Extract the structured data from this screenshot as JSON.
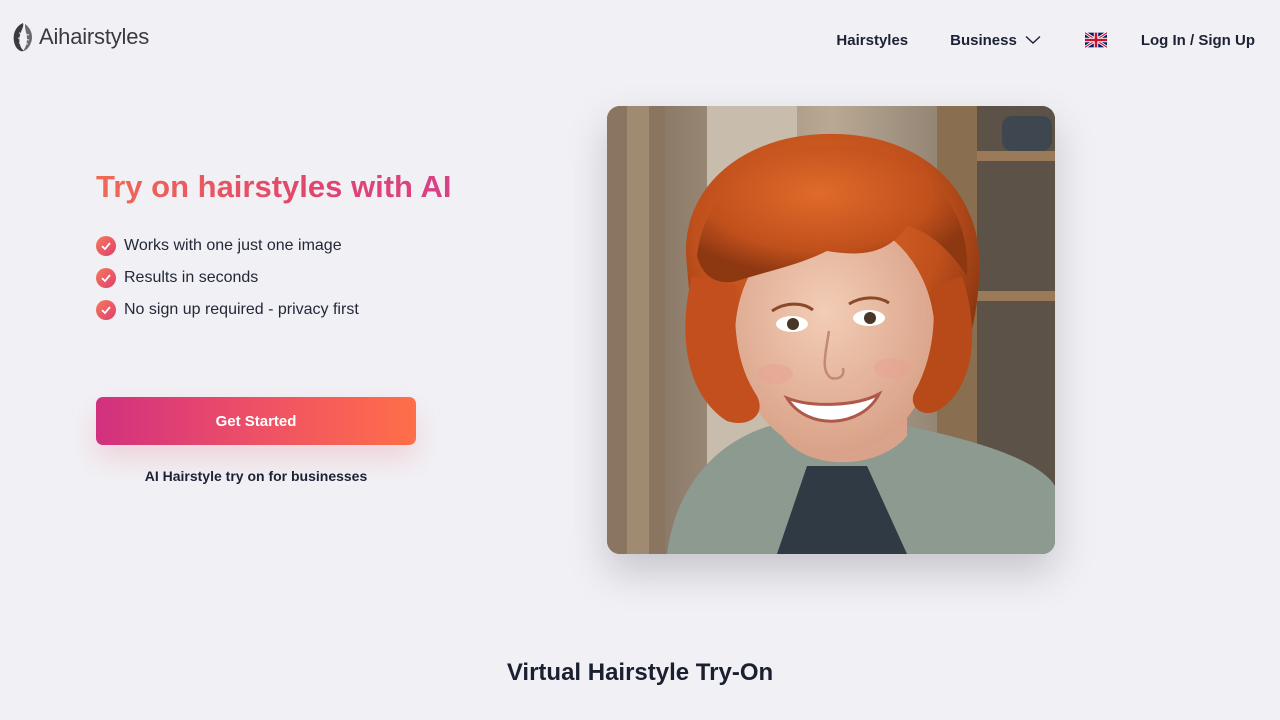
{
  "header": {
    "logo_text": "Aihairstyles",
    "logo_icon": "hair-feather-logo",
    "nav": {
      "hairstyles": "Hairstyles",
      "business": "Business",
      "language_icon": "uk-flag-icon",
      "login": "Log In / Sign Up"
    }
  },
  "hero": {
    "title": "Try on hairstyles with AI",
    "features": [
      "Works with one just one image",
      "Results in seconds",
      "No sign up required - privacy first"
    ],
    "cta_label": "Get Started",
    "business_link": "AI Hairstyle try on for businesses",
    "image_subject": "smiling woman with red bob haircut"
  },
  "sections": {
    "virtual_title": "Virtual Hairstyle Try-On"
  },
  "colors": {
    "background": "#f1f1f5",
    "accent_start": "#d1307f",
    "accent_end": "#ff6e48",
    "text_dark": "#1c2235"
  }
}
